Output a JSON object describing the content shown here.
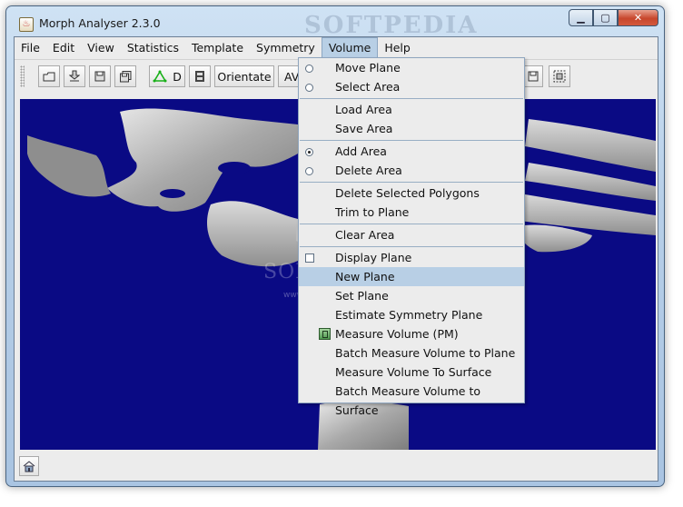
{
  "window": {
    "title": "Morph Analyser 2.3.0",
    "watermark": "SOFTPEDIA"
  },
  "menubar": [
    "File",
    "Edit",
    "View",
    "Statistics",
    "Template",
    "Symmetry",
    "Volume",
    "Help"
  ],
  "toolbar": {
    "d_label": "D",
    "orientate_label": "Orientate",
    "avg_label": "AVG"
  },
  "viewport": {
    "watermark": "SOFTPEDIA",
    "watermark_url": "www.softpedia.com"
  },
  "volume_menu": {
    "groups": [
      [
        {
          "label": "Move Plane",
          "control": "radio",
          "checked": false
        },
        {
          "label": "Select Area",
          "control": "radio",
          "checked": false
        }
      ],
      [
        {
          "label": "Load Area"
        },
        {
          "label": "Save Area"
        }
      ],
      [
        {
          "label": "Add Area",
          "control": "radio",
          "checked": true
        },
        {
          "label": "Delete Area",
          "control": "radio",
          "checked": false
        }
      ],
      [
        {
          "label": "Delete Selected Polygons"
        },
        {
          "label": "Trim to Plane"
        }
      ],
      [
        {
          "label": "Clear Area"
        }
      ],
      [
        {
          "label": "Display Plane",
          "control": "checkbox",
          "checked": false
        },
        {
          "label": "New Plane",
          "highlighted": true
        },
        {
          "label": "Set Plane"
        },
        {
          "label": "Estimate Symmetry Plane"
        },
        {
          "label": "Measure Volume (PM)",
          "icon": "measure-volume-icon"
        },
        {
          "label": "Batch Measure Volume to Plane"
        },
        {
          "label": "Measure Volume To Surface"
        },
        {
          "label": "Batch Measure Volume to Surface"
        }
      ]
    ]
  },
  "colors": {
    "viewport_bg": "#0a0a84",
    "menu_highlight": "#b8cfe5",
    "mesh": "#c6c6c6"
  }
}
